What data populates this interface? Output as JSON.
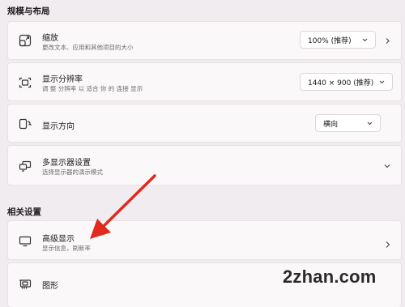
{
  "sections": {
    "scale_layout": "规模与布局",
    "related": "相关设置"
  },
  "cards": {
    "scale": {
      "title": "缩放",
      "subtitle": "更改文本、应用和其他项目的大小",
      "value": "100% (推荐)",
      "icon": "scale-icon"
    },
    "resolution": {
      "title": "显示分辨率",
      "subtitle": "调 整 分辨率 以 适合 你 的 连接 显示",
      "value": "1440 × 900 (推荐)",
      "icon": "resolution-icon"
    },
    "orientation": {
      "title": "显示方向",
      "value": "横向",
      "icon": "orientation-icon"
    },
    "multi_display": {
      "title": "多显示器设置",
      "subtitle": "选择显示器的演示模式",
      "icon": "multi-display-icon"
    },
    "advanced": {
      "title": "高级显示",
      "subtitle": "显示信息，刷新率",
      "icon": "monitor-icon"
    },
    "graphics": {
      "title": "图形",
      "icon": "graphics-card-icon"
    }
  },
  "watermark": "2zhan.com",
  "colors": {
    "background": "#f1ecf0",
    "card": "#fbf8fa",
    "annotation_arrow": "#e02a1e"
  }
}
